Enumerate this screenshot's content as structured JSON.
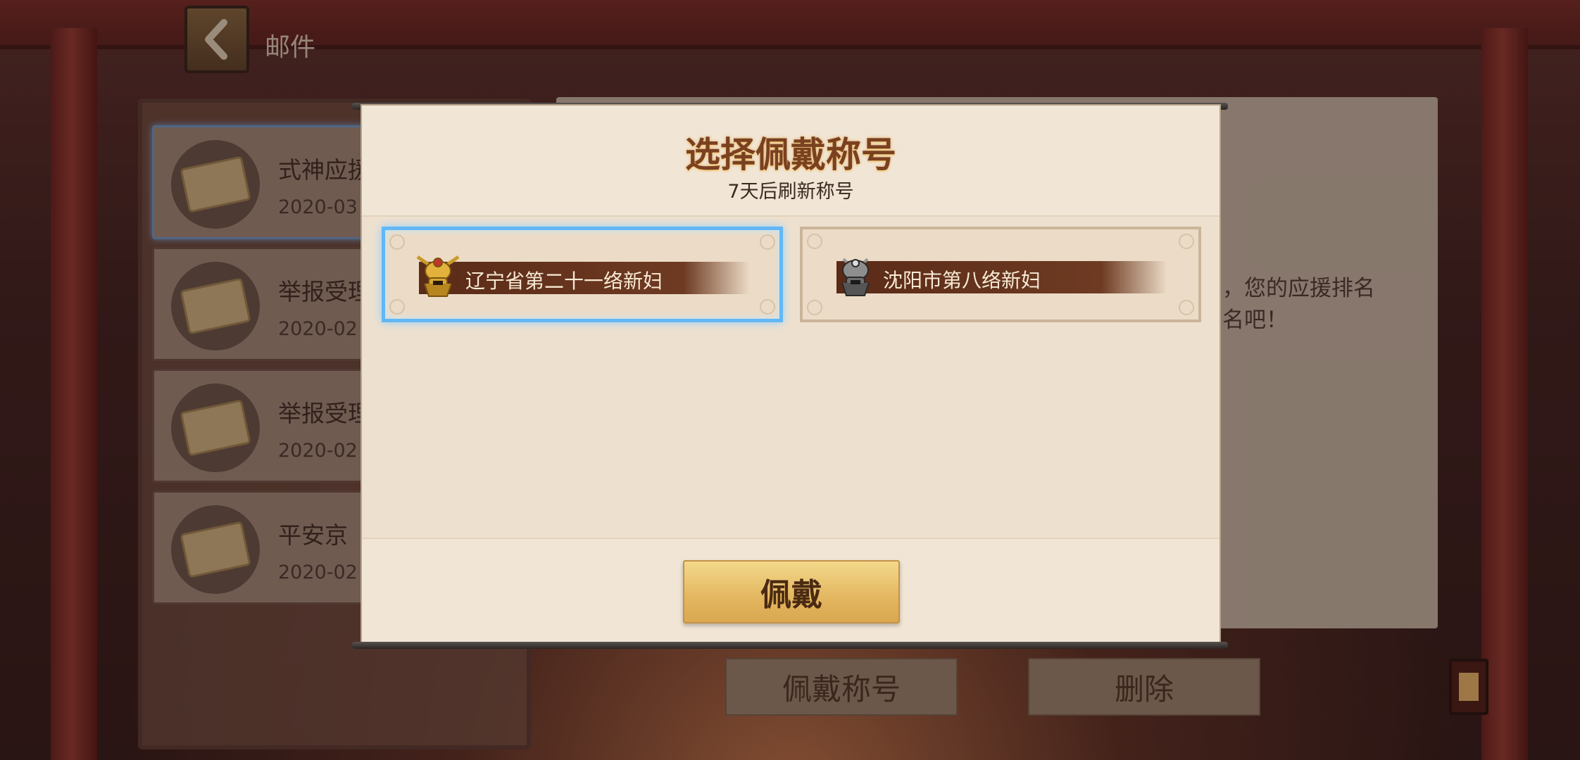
{
  "header": {
    "title": "邮件",
    "back_icon": "chevron-left-icon"
  },
  "mail_list": [
    {
      "title": "式神应援",
      "date": "2020-03",
      "selected": true
    },
    {
      "title": "举报受理",
      "date": "2020-02",
      "selected": false
    },
    {
      "title": "举报受理",
      "date": "2020-02",
      "selected": false
    },
    {
      "title": "平安京",
      "date": "2020-02",
      "selected": false
    }
  ],
  "reading_panel": {
    "text": "，您的应援排名\n名吧！"
  },
  "bottom_actions": {
    "equip_title_label": "佩戴称号",
    "delete_label": "删除"
  },
  "modal": {
    "title": "选择佩戴称号",
    "subtitle": "7天后刷新称号",
    "titles": [
      {
        "label": "辽宁省第二十一络新妇",
        "icon": "gold-helmet-icon",
        "selected": true
      },
      {
        "label": "沈阳市第八络新妇",
        "icon": "silver-helmet-icon",
        "selected": false
      }
    ],
    "equip_button_label": "佩戴"
  },
  "colors": {
    "selected_border": "#63b7f4",
    "title_band": "#5a2b18",
    "gold_button": "#e3b660"
  }
}
